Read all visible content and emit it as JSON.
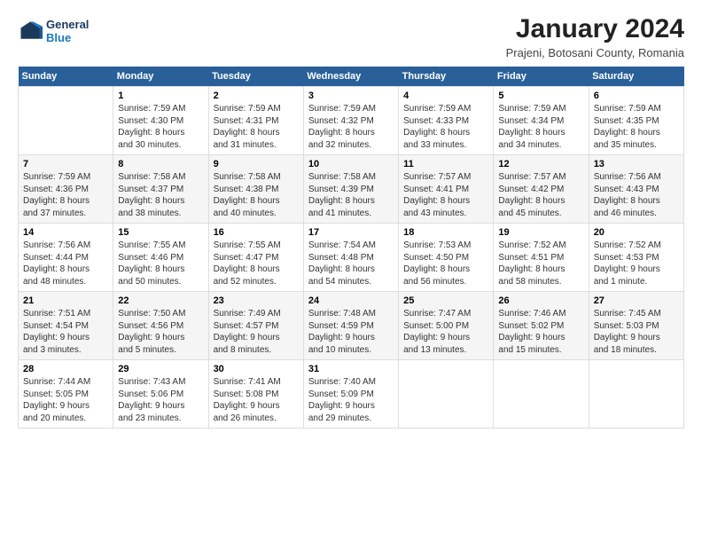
{
  "logo": {
    "line1": "General",
    "line2": "Blue"
  },
  "title": "January 2024",
  "subtitle": "Prajeni, Botosani County, Romania",
  "days_of_week": [
    "Sunday",
    "Monday",
    "Tuesday",
    "Wednesday",
    "Thursday",
    "Friday",
    "Saturday"
  ],
  "weeks": [
    [
      {
        "num": "",
        "text": ""
      },
      {
        "num": "1",
        "text": "Sunrise: 7:59 AM\nSunset: 4:30 PM\nDaylight: 8 hours\nand 30 minutes."
      },
      {
        "num": "2",
        "text": "Sunrise: 7:59 AM\nSunset: 4:31 PM\nDaylight: 8 hours\nand 31 minutes."
      },
      {
        "num": "3",
        "text": "Sunrise: 7:59 AM\nSunset: 4:32 PM\nDaylight: 8 hours\nand 32 minutes."
      },
      {
        "num": "4",
        "text": "Sunrise: 7:59 AM\nSunset: 4:33 PM\nDaylight: 8 hours\nand 33 minutes."
      },
      {
        "num": "5",
        "text": "Sunrise: 7:59 AM\nSunset: 4:34 PM\nDaylight: 8 hours\nand 34 minutes."
      },
      {
        "num": "6",
        "text": "Sunrise: 7:59 AM\nSunset: 4:35 PM\nDaylight: 8 hours\nand 35 minutes."
      }
    ],
    [
      {
        "num": "7",
        "text": "Sunrise: 7:59 AM\nSunset: 4:36 PM\nDaylight: 8 hours\nand 37 minutes."
      },
      {
        "num": "8",
        "text": "Sunrise: 7:58 AM\nSunset: 4:37 PM\nDaylight: 8 hours\nand 38 minutes."
      },
      {
        "num": "9",
        "text": "Sunrise: 7:58 AM\nSunset: 4:38 PM\nDaylight: 8 hours\nand 40 minutes."
      },
      {
        "num": "10",
        "text": "Sunrise: 7:58 AM\nSunset: 4:39 PM\nDaylight: 8 hours\nand 41 minutes."
      },
      {
        "num": "11",
        "text": "Sunrise: 7:57 AM\nSunset: 4:41 PM\nDaylight: 8 hours\nand 43 minutes."
      },
      {
        "num": "12",
        "text": "Sunrise: 7:57 AM\nSunset: 4:42 PM\nDaylight: 8 hours\nand 45 minutes."
      },
      {
        "num": "13",
        "text": "Sunrise: 7:56 AM\nSunset: 4:43 PM\nDaylight: 8 hours\nand 46 minutes."
      }
    ],
    [
      {
        "num": "14",
        "text": "Sunrise: 7:56 AM\nSunset: 4:44 PM\nDaylight: 8 hours\nand 48 minutes."
      },
      {
        "num": "15",
        "text": "Sunrise: 7:55 AM\nSunset: 4:46 PM\nDaylight: 8 hours\nand 50 minutes."
      },
      {
        "num": "16",
        "text": "Sunrise: 7:55 AM\nSunset: 4:47 PM\nDaylight: 8 hours\nand 52 minutes."
      },
      {
        "num": "17",
        "text": "Sunrise: 7:54 AM\nSunset: 4:48 PM\nDaylight: 8 hours\nand 54 minutes."
      },
      {
        "num": "18",
        "text": "Sunrise: 7:53 AM\nSunset: 4:50 PM\nDaylight: 8 hours\nand 56 minutes."
      },
      {
        "num": "19",
        "text": "Sunrise: 7:52 AM\nSunset: 4:51 PM\nDaylight: 8 hours\nand 58 minutes."
      },
      {
        "num": "20",
        "text": "Sunrise: 7:52 AM\nSunset: 4:53 PM\nDaylight: 9 hours\nand 1 minute."
      }
    ],
    [
      {
        "num": "21",
        "text": "Sunrise: 7:51 AM\nSunset: 4:54 PM\nDaylight: 9 hours\nand 3 minutes."
      },
      {
        "num": "22",
        "text": "Sunrise: 7:50 AM\nSunset: 4:56 PM\nDaylight: 9 hours\nand 5 minutes."
      },
      {
        "num": "23",
        "text": "Sunrise: 7:49 AM\nSunset: 4:57 PM\nDaylight: 9 hours\nand 8 minutes."
      },
      {
        "num": "24",
        "text": "Sunrise: 7:48 AM\nSunset: 4:59 PM\nDaylight: 9 hours\nand 10 minutes."
      },
      {
        "num": "25",
        "text": "Sunrise: 7:47 AM\nSunset: 5:00 PM\nDaylight: 9 hours\nand 13 minutes."
      },
      {
        "num": "26",
        "text": "Sunrise: 7:46 AM\nSunset: 5:02 PM\nDaylight: 9 hours\nand 15 minutes."
      },
      {
        "num": "27",
        "text": "Sunrise: 7:45 AM\nSunset: 5:03 PM\nDaylight: 9 hours\nand 18 minutes."
      }
    ],
    [
      {
        "num": "28",
        "text": "Sunrise: 7:44 AM\nSunset: 5:05 PM\nDaylight: 9 hours\nand 20 minutes."
      },
      {
        "num": "29",
        "text": "Sunrise: 7:43 AM\nSunset: 5:06 PM\nDaylight: 9 hours\nand 23 minutes."
      },
      {
        "num": "30",
        "text": "Sunrise: 7:41 AM\nSunset: 5:08 PM\nDaylight: 9 hours\nand 26 minutes."
      },
      {
        "num": "31",
        "text": "Sunrise: 7:40 AM\nSunset: 5:09 PM\nDaylight: 9 hours\nand 29 minutes."
      },
      {
        "num": "",
        "text": ""
      },
      {
        "num": "",
        "text": ""
      },
      {
        "num": "",
        "text": ""
      }
    ]
  ]
}
